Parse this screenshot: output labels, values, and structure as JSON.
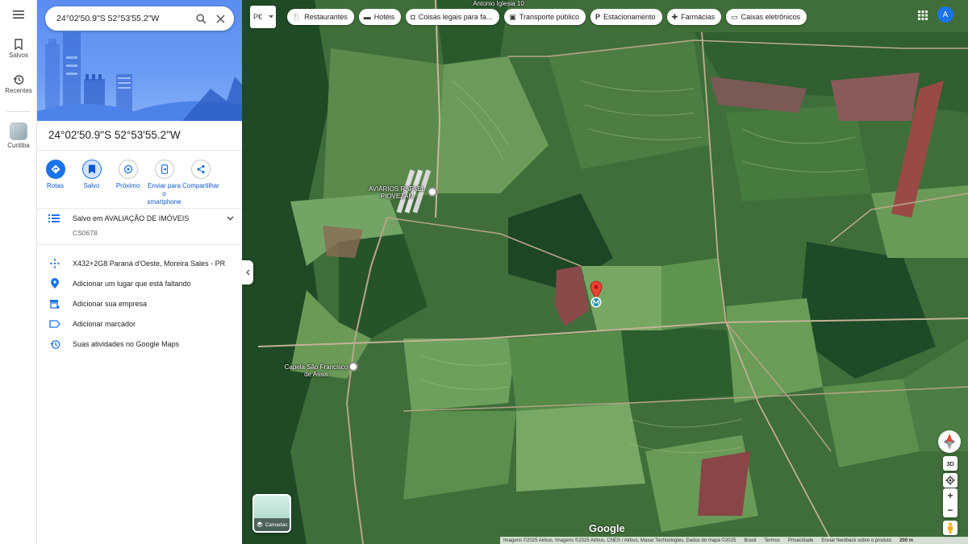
{
  "rail": {
    "saved_label": "Salvos",
    "recent_label": "Recentes",
    "city_label": "Curitiba"
  },
  "search": {
    "value": "24°02'50.9\"S 52°53'55.2\"W"
  },
  "place": {
    "title": "24°02'50.9\"S 52°53'55.2\"W",
    "actions": [
      {
        "label": "Rotas"
      },
      {
        "label": "Salvo"
      },
      {
        "label": "Próximo"
      },
      {
        "label": "Enviar para o smartphone"
      },
      {
        "label": "Compartilhar"
      }
    ],
    "saved_in": "Salvo em AVALIAÇÃO DE IMÓVEIS",
    "saved_note": "CS0678",
    "plus_code": "X432+2G8 Paraná d'Oeste, Moreira Sales - PR",
    "add_place": "Adicionar um lugar que está faltando",
    "add_business": "Adicionar sua empresa",
    "add_label": "Adicionar marcador",
    "activity": "Suas atividades no Google Maps"
  },
  "map": {
    "mode_label": "P€",
    "chips": [
      {
        "icon": "restaurant-icon",
        "label": "Restaurantes"
      },
      {
        "icon": "hotel-icon",
        "label": "Hotéis"
      },
      {
        "icon": "camera-icon",
        "label": "Coisas legais para fa..."
      },
      {
        "icon": "transit-icon",
        "label": "Transporte público"
      },
      {
        "icon": "parking-icon",
        "label": "Estacionamento"
      },
      {
        "icon": "pharmacy-icon",
        "label": "Farmácias"
      },
      {
        "icon": "atm-icon",
        "label": "Caixas eletrônicos"
      }
    ],
    "avatar_letter": "A",
    "poi_aviarios": "AVIÁRIOS RAFAEL PIOVEZAN",
    "poi_capela": "Capela São Francisco de Assis",
    "poi_top": "Antonio Iglesia 10",
    "layers_label": "Camadas",
    "logo": "Google",
    "btn_3d": "3D",
    "zoom_in": "+",
    "zoom_out": "−",
    "attribution": "Imagens ©2025 Airbus, Imagens ©2025 Airbus, CNES / Airbus, Maxar Technologies, Dados do mapa ©2025",
    "attr_country": "Brasil",
    "attr_terms": "Termos",
    "attr_privacy": "Privacidade",
    "attr_feedback": "Enviar feedback sobre o produto",
    "scale": "200 m",
    "accent": "#1a73e8"
  }
}
